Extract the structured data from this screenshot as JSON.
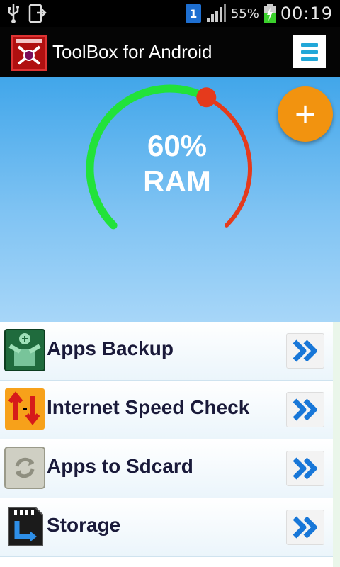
{
  "status_bar": {
    "sim_slot": "1",
    "battery_percent": "55%",
    "time": "00:19"
  },
  "app_bar": {
    "title": "ToolBox for Android",
    "menu_icon": "hamburger-menu-icon"
  },
  "ram_gauge": {
    "percent_label": "60%",
    "label": "RAM",
    "value_percent": 60,
    "used_color": "#e53a1c",
    "free_color": "#22e23a"
  },
  "fab": {
    "symbol": "+",
    "color": "#f2930f"
  },
  "menu_items": [
    {
      "label": "Apps Backup",
      "icon": "apps-backup-icon"
    },
    {
      "label": "Internet Speed Check",
      "icon": "speed-check-icon"
    },
    {
      "label": "Apps to Sdcard",
      "icon": "sdcard-move-icon"
    },
    {
      "label": "Storage",
      "icon": "storage-icon"
    }
  ]
}
